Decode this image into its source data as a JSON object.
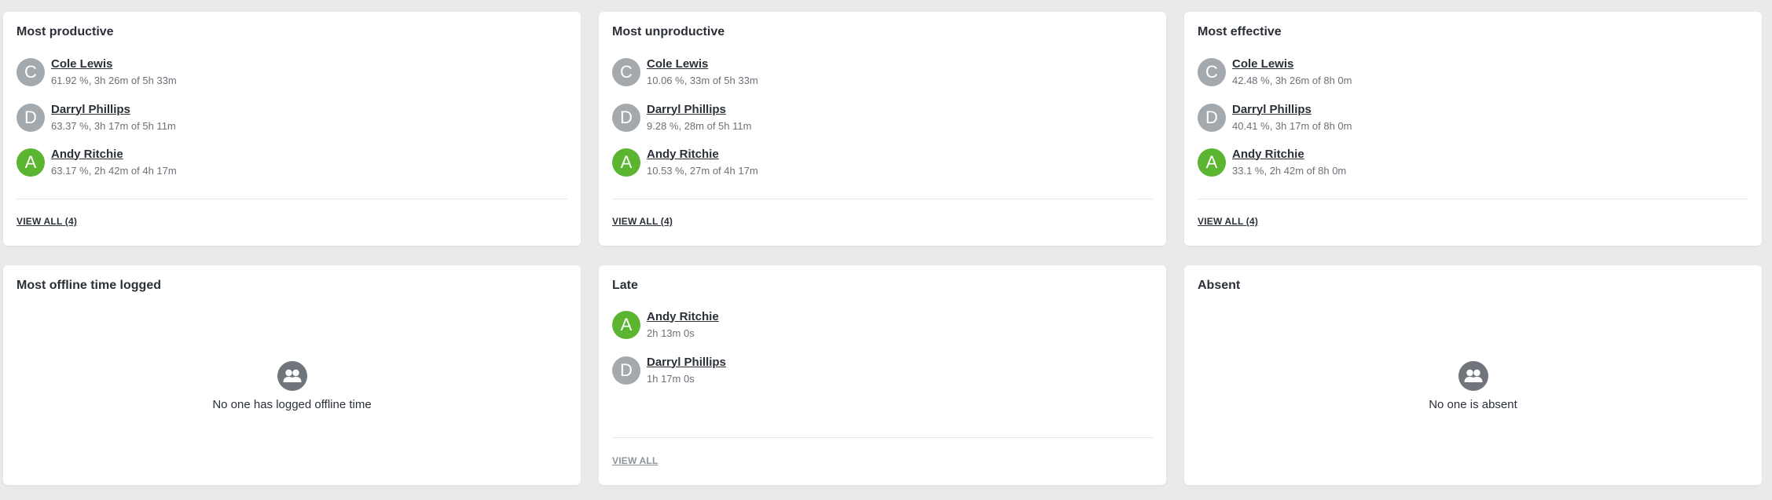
{
  "cards": {
    "most_productive": {
      "title": "Most productive",
      "people": [
        {
          "initial": "C",
          "name": "Cole Lewis",
          "stat": "61.92 %, 3h 26m of 5h 33m"
        },
        {
          "initial": "D",
          "name": "Darryl Phillips",
          "stat": "63.37 %, 3h 17m of 5h 11m"
        },
        {
          "initial": "A",
          "name": "Andy Ritchie",
          "stat": "63.17 %, 2h 42m of 4h 17m"
        }
      ],
      "view_all": "VIEW ALL (4)"
    },
    "most_unproductive": {
      "title": "Most unproductive",
      "people": [
        {
          "initial": "C",
          "name": "Cole Lewis",
          "stat": "10.06 %, 33m of 5h 33m"
        },
        {
          "initial": "D",
          "name": "Darryl Phillips",
          "stat": "9.28 %, 28m of 5h 11m"
        },
        {
          "initial": "A",
          "name": "Andy Ritchie",
          "stat": "10.53 %, 27m of 4h 17m"
        }
      ],
      "view_all": "VIEW ALL (4)"
    },
    "most_effective": {
      "title": "Most effective",
      "people": [
        {
          "initial": "C",
          "name": "Cole Lewis",
          "stat": "42.48 %, 3h 26m of 8h 0m"
        },
        {
          "initial": "D",
          "name": "Darryl Phillips",
          "stat": "40.41 %, 3h 17m of 8h 0m"
        },
        {
          "initial": "A",
          "name": "Andy Ritchie",
          "stat": "33.1 %, 2h 42m of 8h 0m"
        }
      ],
      "view_all": "VIEW ALL (4)"
    },
    "most_offline": {
      "title": "Most offline time logged",
      "empty_text": "No one has logged offline time",
      "icon": "users-icon"
    },
    "late": {
      "title": "Late",
      "people": [
        {
          "initial": "A",
          "name": "Andy Ritchie",
          "stat": "2h 13m 0s"
        },
        {
          "initial": "D",
          "name": "Darryl Phillips",
          "stat": "1h 17m 0s"
        }
      ],
      "view_all": "VIEW ALL"
    },
    "absent": {
      "title": "Absent",
      "empty_text": "No one is absent",
      "icon": "users-icon"
    }
  },
  "colors": {
    "background": "#e9ebea",
    "avatar_gray": "#a4a9ae",
    "avatar_green": "#5bb531",
    "text": "#2b3038",
    "muted": "#6b7178"
  }
}
